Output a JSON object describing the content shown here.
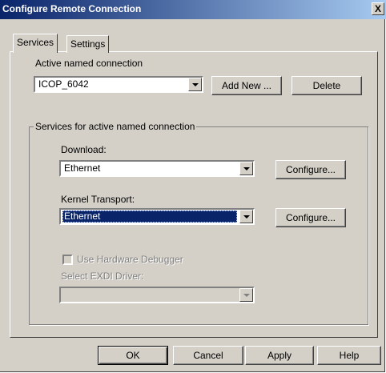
{
  "window": {
    "title": "Configure Remote Connection",
    "close_glyph": "X"
  },
  "tabs": [
    {
      "label": "Services",
      "active": true
    },
    {
      "label": "Settings",
      "active": false
    }
  ],
  "active_connection": {
    "label": "Active named connection",
    "value": "ICOP_6042",
    "add_new_label": "Add New ...",
    "delete_label": "Delete"
  },
  "services": {
    "group_title": "Services for active named connection",
    "download": {
      "label": "Download:",
      "value": "Ethernet",
      "configure_label": "Configure..."
    },
    "kernel_transport": {
      "label": "Kernel Transport:",
      "value": "Ethernet",
      "configure_label": "Configure..."
    },
    "hardware_debugger": {
      "label": "Use Hardware Debugger",
      "checked": false,
      "enabled": false
    },
    "exdi_driver": {
      "label": "Select EXDI Driver:",
      "value": "",
      "enabled": false
    }
  },
  "footer": {
    "ok_label": "OK",
    "cancel_label": "Cancel",
    "apply_label": "Apply",
    "help_label": "Help"
  },
  "colors": {
    "face": "#d4d0c8",
    "titlebar_start": "#0a246a",
    "titlebar_end": "#a6caf0",
    "selection": "#0a246a"
  }
}
